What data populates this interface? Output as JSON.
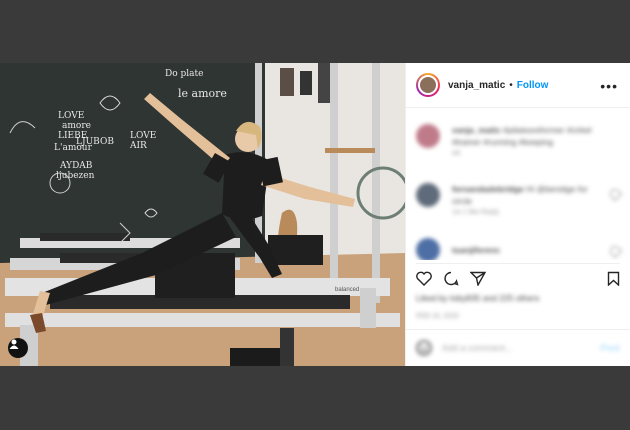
{
  "header": {
    "username": "vanja_matic",
    "separator": "•",
    "follow_label": "Follow",
    "more_label": "•••"
  },
  "photo": {
    "chalk": {
      "love": "LOVE",
      "amore": "amore",
      "liebe": "LIEBE",
      "ljubav": "LJUBOB",
      "lamour": "L'amour",
      "aydab": "AYDAB",
      "ljubezen": "ljubezen",
      "do_plate": "Do plate",
      "to_air": "LOVE\nAIR",
      "script": "le amore"
    },
    "machine_brand": "balanced"
  },
  "comments": [
    {
      "user": "vanja_matic",
      "text": "#pilatesreformer #cirkel #trainer #running #keeping",
      "meta": "wk"
    },
    {
      "user": "fernandadebridge",
      "text": "Hi @benidge for circle",
      "meta": "1w   1 like   Reply"
    },
    {
      "user": "tuanjiferenc",
      "text": "",
      "meta": ""
    }
  ],
  "actions": {
    "likes_text": "Liked by toby835 and 225 others",
    "date_text": "FEB 18, 2020"
  },
  "add_comment": {
    "placeholder": "Add a comment...",
    "post_label": "Post"
  },
  "colors": {
    "link": "#0095f6",
    "chalkboard": "#2f3533",
    "floor": "#c9a27c"
  }
}
